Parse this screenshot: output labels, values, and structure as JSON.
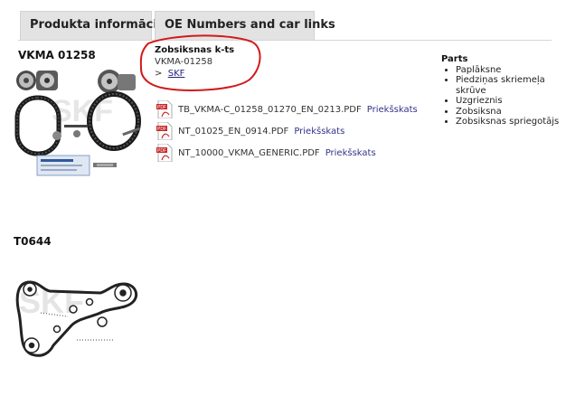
{
  "tabs": [
    {
      "label": "Produkta informācija"
    },
    {
      "label": "OE Numbers and car links"
    }
  ],
  "product": {
    "code": "VKMA 01258"
  },
  "supplier": {
    "heading": "Zobsiksnas k-ts",
    "number": "VKMA-01258",
    "brand_prefix": ">",
    "brand": "SKF"
  },
  "documents": [
    {
      "file": "TB_VKMA-C_01258_01270_EN_0213.PDF",
      "preview": "Priekšskats",
      "icon": "pdf-icon"
    },
    {
      "file": "NT_01025_EN_0914.PDF",
      "preview": "Priekšskats",
      "icon": "pdf-icon"
    },
    {
      "file": "NT_10000_VKMA_GENERIC.PDF",
      "preview": "Priekšskats",
      "icon": "pdf-icon"
    }
  ],
  "parts": {
    "heading": "Parts",
    "items": [
      "Paplāksne",
      "Piedziņas skriemeļa skrūve",
      "Uzgrieznis",
      "Zobsiksna",
      "Zobsiksnas spriegotājs"
    ]
  },
  "diagram": {
    "code": "T0644"
  },
  "colors": {
    "tab_bg": "#e3e3e3",
    "link": "#33338a",
    "annotation": "#d21a1a",
    "pdf_red": "#c62828"
  }
}
